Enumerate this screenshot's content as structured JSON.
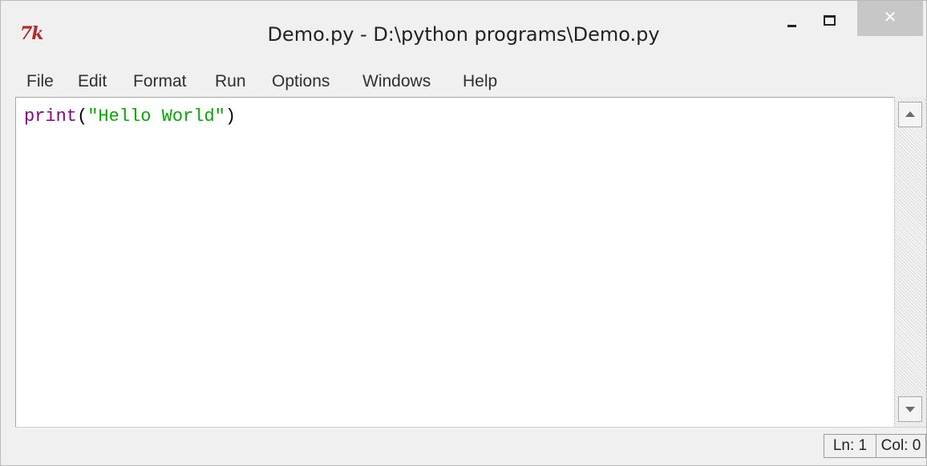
{
  "window": {
    "title": "Demo.py - D:\\python programs\\Demo.py",
    "app_icon_text": "7k",
    "close_glyph": "✕"
  },
  "menu": {
    "items": [
      "File",
      "Edit",
      "Format",
      "Run",
      "Options",
      "Windows",
      "Help"
    ]
  },
  "editor": {
    "lines": [
      {
        "tokens": [
          {
            "text": "print",
            "kind": "builtin"
          },
          {
            "text": "(",
            "kind": "paren"
          },
          {
            "text": "\"Hello World\"",
            "kind": "string"
          },
          {
            "text": ")",
            "kind": "paren"
          }
        ]
      }
    ]
  },
  "status": {
    "line": "Ln: 1",
    "col": "Col: 0"
  },
  "icons": {
    "app": "tk-feather-icon",
    "minimize": "minimize-icon",
    "maximize": "maximize-icon",
    "close": "close-icon",
    "scroll_up": "scroll-up-arrow-icon",
    "scroll_down": "scroll-down-arrow-icon"
  },
  "colors": {
    "builtin": "#900090",
    "string": "#00aa00",
    "close_button": "#c7c7c7",
    "app_icon": "#b12a2a"
  }
}
